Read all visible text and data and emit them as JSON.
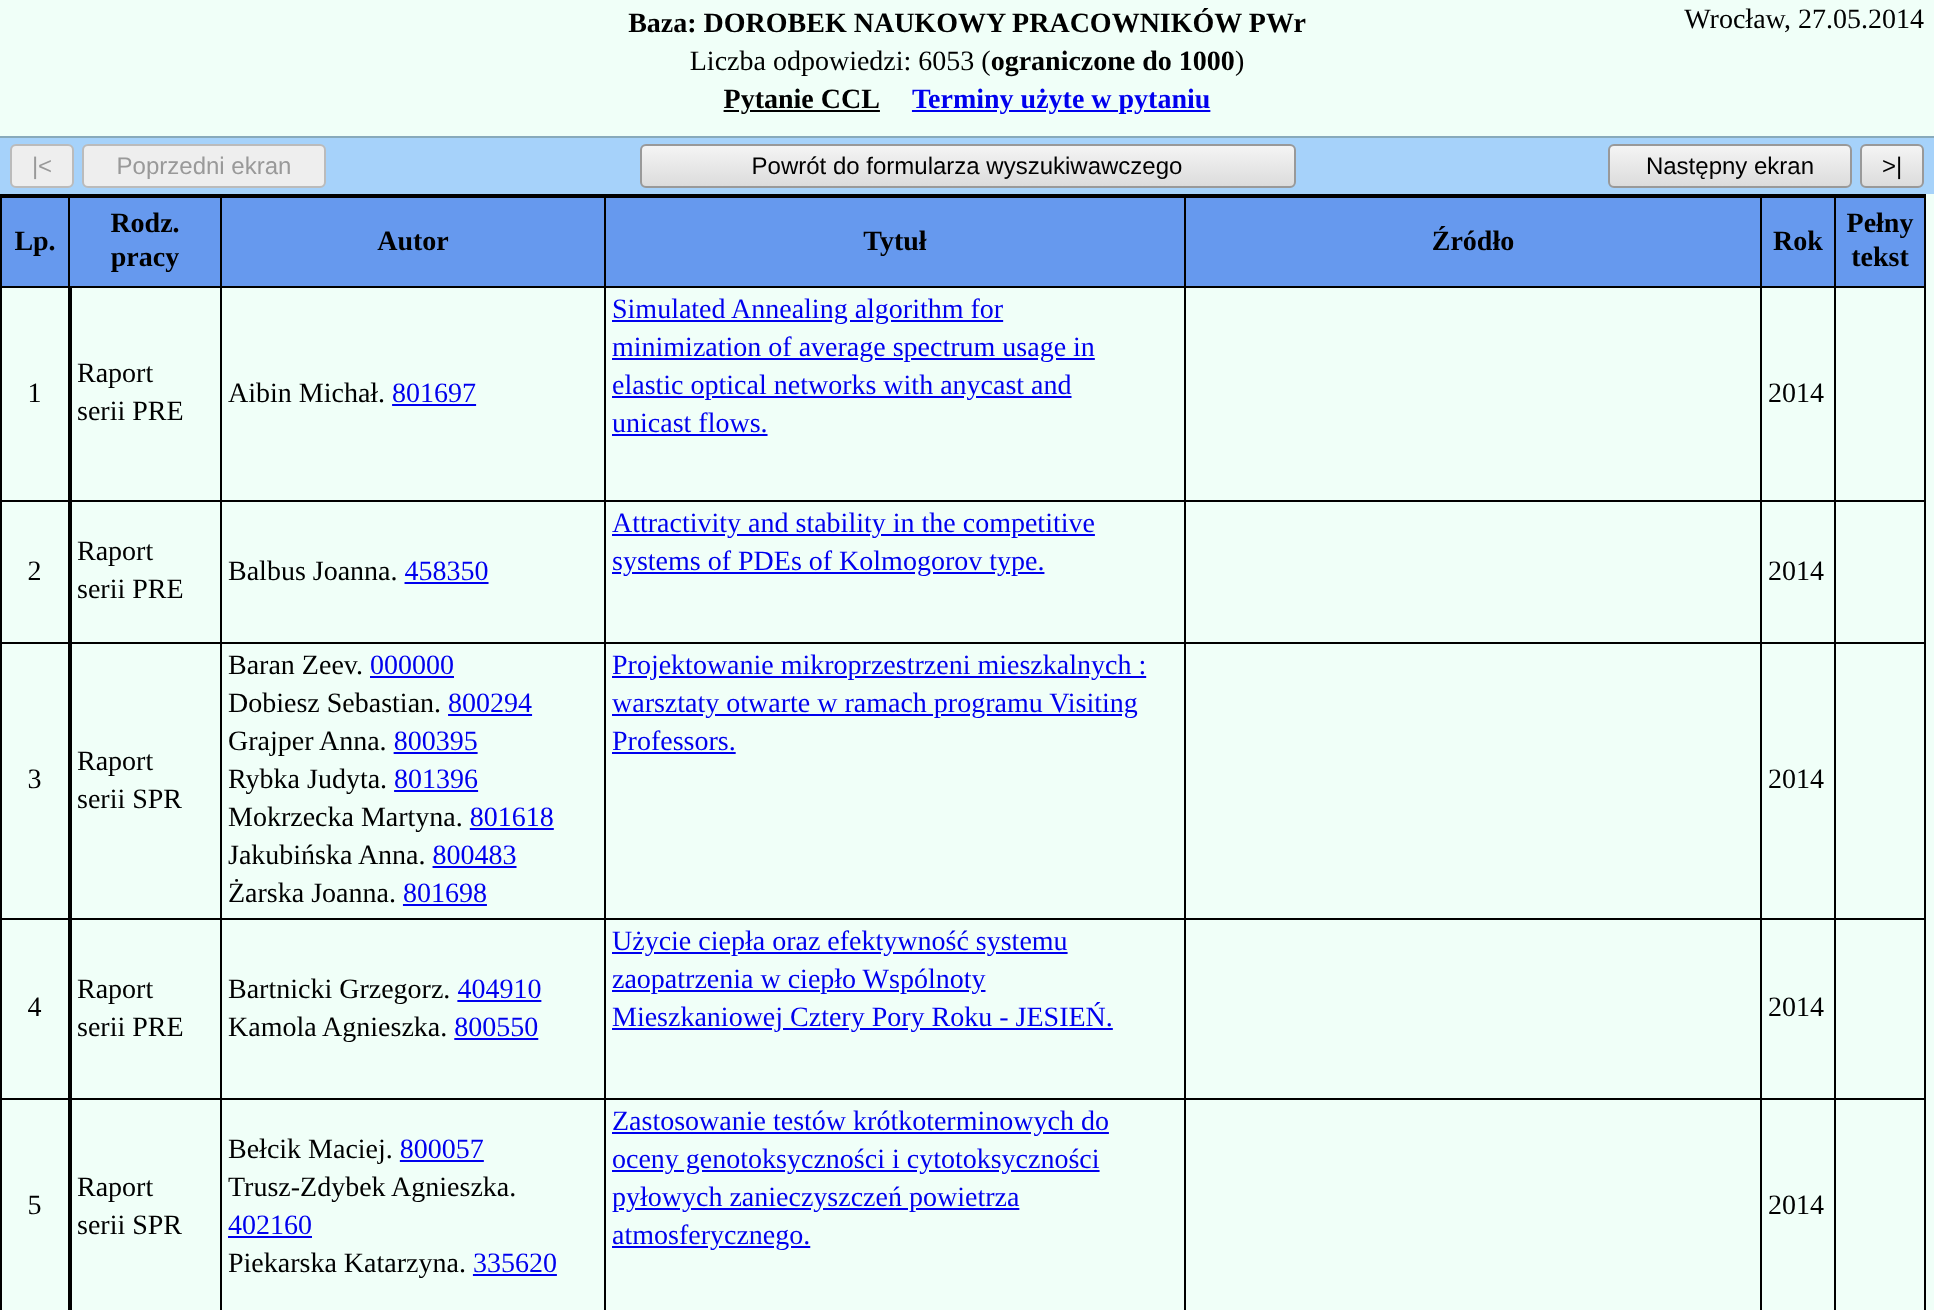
{
  "header": {
    "database": "Baza: DOROBEK NAUKOWY PRACOWNIKÓW PWr",
    "count_text": "Liczba odpowiedzi: 6053 (**ograniczone do 1000**)",
    "links": [
      {
        "label": "Pytanie CCL",
        "kind": "plain"
      },
      {
        "label": "Terminy użyte w pytaniu",
        "kind": "link"
      }
    ],
    "date": "Wrocław, 27.05.2014"
  },
  "toolbar": {
    "left": [
      {
        "label": "|<",
        "disabled": true
      },
      {
        "label": "Poprzedni ekran",
        "disabled": true
      }
    ],
    "center": [
      {
        "label": "Powrót do formularza wyszukiwawczego",
        "disabled": false
      }
    ],
    "right": [
      {
        "label": "Następny ekran",
        "disabled": false
      },
      {
        "label": ">|",
        "disabled": false
      }
    ]
  },
  "table": {
    "columns": [
      "Lp.",
      "Rodz. pracy",
      "Autor",
      "Tytuł",
      "Źródło",
      "Rok",
      "Pełny tekst"
    ],
    "rows": [
      {
        "lp": "1",
        "type": "Raport serii PRE",
        "authors": [
          {
            "name": "Aibin Michał.",
            "id": "801697"
          }
        ],
        "title": "Simulated Annealing algorithm for minimization of average spectrum usage in elastic optical networks with anycast and unicast flows.",
        "year": "2014"
      },
      {
        "lp": "2",
        "type": "Raport serii PRE",
        "authors": [
          {
            "name": "Balbus Joanna.",
            "id": "458350"
          }
        ],
        "title": "Attractivity and stability in the competitive systems of PDEs of Kolmogorov type.",
        "year": "2014"
      },
      {
        "lp": "3",
        "type": "Raport serii SPR",
        "authors": [
          {
            "name": "Baran Zeev.",
            "id": "000000"
          },
          {
            "name": "Dobiesz Sebastian.",
            "id": "800294"
          },
          {
            "name": "Grajper Anna.",
            "id": "800395"
          },
          {
            "name": "Rybka Judyta.",
            "id": "801396"
          },
          {
            "name": "Mokrzecka Martyna.",
            "id": "801618"
          },
          {
            "name": "Jakubińska Anna.",
            "id": "800483"
          },
          {
            "name": "Żarska Joanna.",
            "id": "801698"
          }
        ],
        "title": "Projektowanie mikroprzestrzeni mieszkalnych : warsztaty otwarte w ramach programu Visiting Professors.",
        "year": "2014"
      },
      {
        "lp": "4",
        "type": "Raport serii PRE",
        "authors": [
          {
            "name": "Bartnicki Grzegorz.",
            "id": "404910"
          },
          {
            "name": "Kamola Agnieszka.",
            "id": "800550"
          }
        ],
        "title": "Użycie ciepła oraz efektywność systemu zaopatrzenia w ciepło Wspólnoty Mieszkaniowej Cztery Pory Roku - JESIEŃ.",
        "year": "2014"
      },
      {
        "lp": "5",
        "type": "Raport serii SPR",
        "authors": [
          {
            "name": "Bełcik Maciej.",
            "id": "800057"
          },
          {
            "name": "Trusz-Zdybek Agnieszka.",
            "id": "402160"
          },
          {
            "name": "Piekarska Katarzyna.",
            "id": "335620"
          }
        ],
        "title": "Zastosowanie testów krótkoterminowych do oceny genotoksyczności i cytotoksyczności pyłowych zanieczyszczeń powietrza atmosferycznego.",
        "year": "2014"
      }
    ]
  }
}
